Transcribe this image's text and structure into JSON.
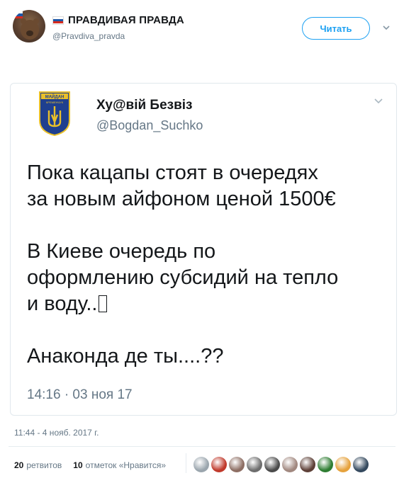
{
  "header": {
    "display_name": "ПРАВДИВАЯ ПРАВДА",
    "handle": "@Pravdiva_pravda",
    "follow_label": "Читать",
    "flag_colors": [
      "#ffffff",
      "#1c57a7",
      "#d52b1e"
    ]
  },
  "quoted": {
    "display_name": "Ху@вій Безвіз",
    "handle": "@Bogdan_Suchko",
    "badge_text_top": "МАЙДАН",
    "badge_text_bottom": "КРЕМЕНЧУК",
    "line1": "Пока кацапы стоят в очередях",
    "line2": "за новым айфоном ценой 1500€",
    "line3": "В Киеве очередь по",
    "line4": "оформлению субсидий на тепло",
    "line5": "и воду..",
    "line6": "Анаконда де ты....??",
    "time": "14:16 · 03 ноя 17"
  },
  "timestamp": "11:44 - 4 нояб. 2017 г.",
  "stats": {
    "retweets_count": "20",
    "retweets_label": "ретвитов",
    "likes_count": "10",
    "likes_label": "отметок «Нравится»"
  },
  "liker_colors": [
    "#9aa5ad",
    "#c0392b",
    "#8d6e63",
    "#6d6d6d",
    "#4a4a4a",
    "#a1887f",
    "#5d4037",
    "#2e7d32",
    "#e6a23c",
    "#34495e"
  ],
  "accent": "#1da1f2"
}
